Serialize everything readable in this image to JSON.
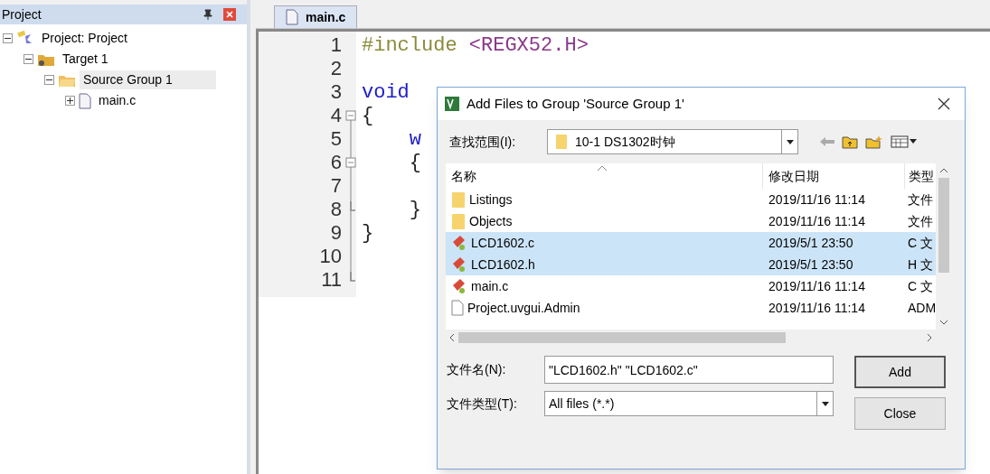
{
  "project_panel": {
    "title": "Project",
    "tree": [
      {
        "label": "Project: Project",
        "expanded": true,
        "selected": false,
        "children": [
          {
            "label": "Target 1",
            "expanded": true,
            "selected": false,
            "children": [
              {
                "label": "Source Group 1",
                "expanded": true,
                "selected": true,
                "children": [
                  {
                    "label": "main.c",
                    "expanded": false,
                    "selected": false
                  }
                ]
              }
            ]
          }
        ]
      }
    ]
  },
  "editor": {
    "tabs": [
      {
        "label": "main.c",
        "selected": true
      }
    ],
    "lines": [
      {
        "number": "1",
        "tokens": [
          {
            "text": "#include",
            "kind": "preproc"
          },
          {
            "text": "<REGX52.H>",
            "kind": "string"
          }
        ]
      },
      {
        "number": "2"
      },
      {
        "number": "3",
        "tokens": [
          {
            "text": "void",
            "kind": "keyword"
          }
        ]
      },
      {
        "number": "4",
        "fold_start": true,
        "tokens": [
          {
            "text": "{",
            "kind": "plain"
          }
        ]
      },
      {
        "number": "5",
        "tokens": [
          {
            "text": "    w",
            "kind": "keyword"
          }
        ]
      },
      {
        "number": "6",
        "fold_start": true,
        "tokens": [
          {
            "text": "    {",
            "kind": "plain"
          }
        ]
      },
      {
        "number": "7"
      },
      {
        "number": "8",
        "fold_end": true,
        "tokens": [
          {
            "text": "    }",
            "kind": "plain"
          }
        ]
      },
      {
        "number": "9",
        "tokens": [
          {
            "text": "}",
            "kind": "plain"
          }
        ]
      },
      {
        "number": "10"
      },
      {
        "number": "11",
        "fold_end": true
      }
    ]
  },
  "dialog": {
    "title": "Add Files to Group 'Source Group 1'",
    "look_in": {
      "label": "查找范围(I):",
      "value": "10-1 DS1302时钟"
    },
    "columns": [
      "名称",
      "修改日期",
      "类型"
    ],
    "files": [
      {
        "name": "Listings",
        "date": "2019/11/16 11:14",
        "type": "文件",
        "kind": "folder",
        "selected": false
      },
      {
        "name": "Objects",
        "date": "2019/11/16 11:14",
        "type": "文件",
        "kind": "folder",
        "selected": false
      },
      {
        "name": "LCD1602.c",
        "date": "2019/5/1 23:50",
        "type": "C 文",
        "kind": "source",
        "selected": true
      },
      {
        "name": "LCD1602.h",
        "date": "2019/5/1 23:50",
        "type": "H 文",
        "kind": "source",
        "selected": true
      },
      {
        "name": "main.c",
        "date": "2019/11/16 11:14",
        "type": "C 文",
        "kind": "source",
        "selected": false
      },
      {
        "name": "Project.uvgui.Admin",
        "date": "2019/11/16 11:14",
        "type": "ADM",
        "kind": "document",
        "selected": false
      }
    ],
    "file_name": {
      "label": "文件名(N):",
      "value": "\"LCD1602.h\" \"LCD1602.c\""
    },
    "file_type": {
      "label": "文件类型(T):",
      "value": "All files (*.*)"
    },
    "buttons": [
      "Add",
      "Close"
    ]
  }
}
